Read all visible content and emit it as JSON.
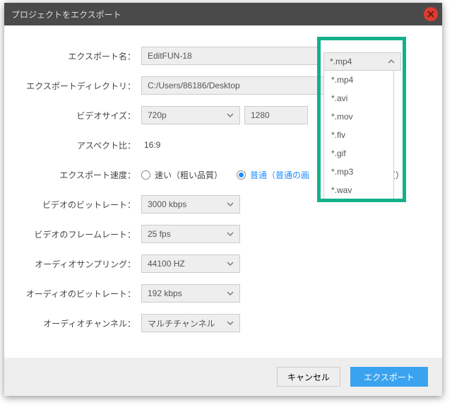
{
  "window": {
    "title": "プロジェクトをエクスポート"
  },
  "labels": {
    "export_name": "エクスポート名：",
    "export_dir": "エクスポートディレクトリ：",
    "video_size": "ビデオサイズ：",
    "aspect": "アスペクト比：",
    "speed": "エクスポート速度：",
    "v_bitrate": "ビデオのビットレート：",
    "v_framerate": "ビデオのフレームレート：",
    "a_sampling": "オーディオサンプリング：",
    "a_bitrate": "オーディオのビットレート：",
    "a_channel": "オーディオチャンネル："
  },
  "values": {
    "export_name": "EditFUN-18",
    "export_dir": "C:/Users/86186/Desktop",
    "video_size": "720p",
    "width": "1280",
    "aspect": "16:9",
    "v_bitrate": "3000 kbps",
    "v_framerate": "25 fps",
    "a_sampling": "44100 HZ",
    "a_bitrate": "192 kbps",
    "a_channel": "マルチチャンネル"
  },
  "speed": {
    "fast": "速い（粗い品質）",
    "normal_a": "普通（普通の画",
    "normal_b": "画質）",
    "selected": "normal"
  },
  "format": {
    "selected": "*.mp4",
    "options": [
      "*.mp4",
      "*.avi",
      "*.mov",
      "*.flv",
      "*.gif",
      "*.mp3",
      "*.wav"
    ]
  },
  "buttons": {
    "cancel": "キャンセル",
    "export": "エクスポート"
  }
}
